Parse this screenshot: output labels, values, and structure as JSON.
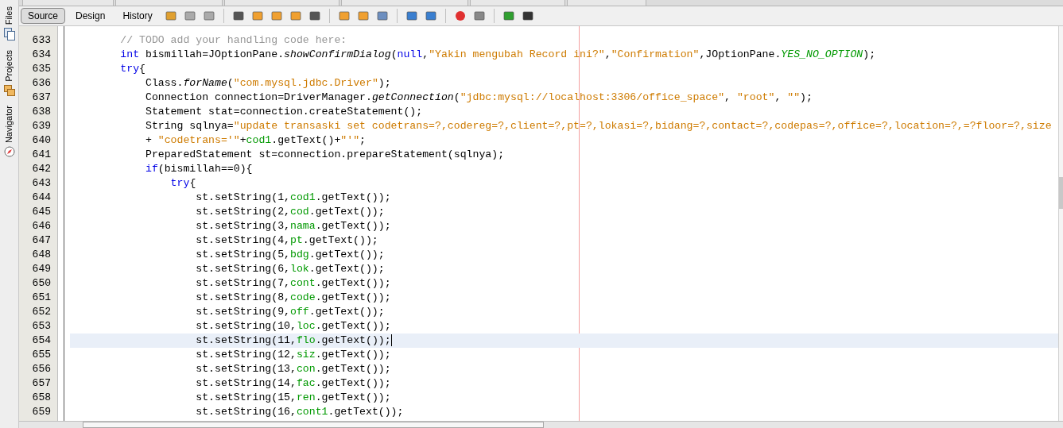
{
  "side_tabs": [
    {
      "label": "Files"
    },
    {
      "label": "Projects"
    },
    {
      "label": "Navigator"
    }
  ],
  "view_tabs": [
    {
      "label": "Source",
      "selected": true
    },
    {
      "label": "Design",
      "selected": false
    },
    {
      "label": "History",
      "selected": false
    }
  ],
  "lines": [
    {
      "number": "633",
      "current": false,
      "tokens": [
        {
          "kind": "comment",
          "text": "        // TODO add your handling code here:"
        }
      ]
    },
    {
      "number": "634",
      "current": false,
      "tokens": [
        {
          "kind": "keyword",
          "text": "        int"
        },
        {
          "kind": "plain",
          "text": " bismillah=JOptionPane."
        },
        {
          "kind": "method",
          "text": "showConfirmDialog"
        },
        {
          "kind": "plain",
          "text": "("
        },
        {
          "kind": "keyword",
          "text": "null"
        },
        {
          "kind": "plain",
          "text": ","
        },
        {
          "kind": "string",
          "text": "\"Yakin mengubah Record ini?\""
        },
        {
          "kind": "plain",
          "text": ","
        },
        {
          "kind": "string",
          "text": "\"Confirmation\""
        },
        {
          "kind": "plain",
          "text": ",JOptionPane."
        },
        {
          "kind": "constant",
          "text": "YES_NO_OPTION"
        },
        {
          "kind": "plain",
          "text": ");"
        }
      ]
    },
    {
      "number": "635",
      "current": false,
      "tokens": [
        {
          "kind": "keyword",
          "text": "        try"
        },
        {
          "kind": "plain",
          "text": "{"
        }
      ]
    },
    {
      "number": "636",
      "current": false,
      "tokens": [
        {
          "kind": "plain",
          "text": "            Class."
        },
        {
          "kind": "method",
          "text": "forName"
        },
        {
          "kind": "plain",
          "text": "("
        },
        {
          "kind": "string",
          "text": "\"com.mysql.jdbc.Driver\""
        },
        {
          "kind": "plain",
          "text": ");"
        }
      ]
    },
    {
      "number": "637",
      "current": false,
      "tokens": [
        {
          "kind": "plain",
          "text": "            Connection connection=DriverManager."
        },
        {
          "kind": "method",
          "text": "getConnection"
        },
        {
          "kind": "plain",
          "text": "("
        },
        {
          "kind": "string",
          "text": "\"jdbc:mysql://localhost:3306/office_space\""
        },
        {
          "kind": "plain",
          "text": ", "
        },
        {
          "kind": "string",
          "text": "\"root\""
        },
        {
          "kind": "plain",
          "text": ", "
        },
        {
          "kind": "string",
          "text": "\"\""
        },
        {
          "kind": "plain",
          "text": ");"
        }
      ]
    },
    {
      "number": "638",
      "current": false,
      "tokens": [
        {
          "kind": "plain",
          "text": "            Statement stat=connection.createStatement();"
        }
      ]
    },
    {
      "number": "639",
      "current": false,
      "tokens": [
        {
          "kind": "plain",
          "text": "            String sqlnya="
        },
        {
          "kind": "string",
          "text": "\"update transaski set codetrans=?,codereg=?,client=?,pt=?,lokasi=?,bidang=?,contact=?,codepas=?,office=?,location=?,=?floor=?,size"
        }
      ]
    },
    {
      "number": "640",
      "current": false,
      "tokens": [
        {
          "kind": "plain",
          "text": "            + "
        },
        {
          "kind": "string",
          "text": "\"codetrans='\""
        },
        {
          "kind": "plain",
          "text": "+"
        },
        {
          "kind": "field",
          "text": "cod1"
        },
        {
          "kind": "plain",
          "text": ".getText()+"
        },
        {
          "kind": "string",
          "text": "\"'\""
        },
        {
          "kind": "plain",
          "text": ";"
        }
      ]
    },
    {
      "number": "641",
      "current": false,
      "tokens": [
        {
          "kind": "plain",
          "text": "            PreparedStatement st=connection.prepareStatement(sqlnya);"
        }
      ]
    },
    {
      "number": "642",
      "current": false,
      "tokens": [
        {
          "kind": "keyword",
          "text": "            if"
        },
        {
          "kind": "plain",
          "text": "(bismillah==0){"
        }
      ]
    },
    {
      "number": "643",
      "current": false,
      "tokens": [
        {
          "kind": "keyword",
          "text": "                try"
        },
        {
          "kind": "plain",
          "text": "{"
        }
      ]
    },
    {
      "number": "644",
      "current": false,
      "tokens": [
        {
          "kind": "plain",
          "text": "                    st.setString(1,"
        },
        {
          "kind": "field",
          "text": "cod1"
        },
        {
          "kind": "plain",
          "text": ".getText());"
        }
      ]
    },
    {
      "number": "645",
      "current": false,
      "tokens": [
        {
          "kind": "plain",
          "text": "                    st.setString(2,"
        },
        {
          "kind": "field",
          "text": "cod"
        },
        {
          "kind": "plain",
          "text": ".getText());"
        }
      ]
    },
    {
      "number": "646",
      "current": false,
      "tokens": [
        {
          "kind": "plain",
          "text": "                    st.setString(3,"
        },
        {
          "kind": "field",
          "text": "nama"
        },
        {
          "kind": "plain",
          "text": ".getText());"
        }
      ]
    },
    {
      "number": "647",
      "current": false,
      "tokens": [
        {
          "kind": "plain",
          "text": "                    st.setString(4,"
        },
        {
          "kind": "field",
          "text": "pt"
        },
        {
          "kind": "plain",
          "text": ".getText());"
        }
      ]
    },
    {
      "number": "648",
      "current": false,
      "tokens": [
        {
          "kind": "plain",
          "text": "                    st.setString(5,"
        },
        {
          "kind": "field",
          "text": "bdg"
        },
        {
          "kind": "plain",
          "text": ".getText());"
        }
      ]
    },
    {
      "number": "649",
      "current": false,
      "tokens": [
        {
          "kind": "plain",
          "text": "                    st.setString(6,"
        },
        {
          "kind": "field",
          "text": "lok"
        },
        {
          "kind": "plain",
          "text": ".getText());"
        }
      ]
    },
    {
      "number": "650",
      "current": false,
      "tokens": [
        {
          "kind": "plain",
          "text": "                    st.setString(7,"
        },
        {
          "kind": "field",
          "text": "cont"
        },
        {
          "kind": "plain",
          "text": ".getText());"
        }
      ]
    },
    {
      "number": "651",
      "current": false,
      "tokens": [
        {
          "kind": "plain",
          "text": "                    st.setString(8,"
        },
        {
          "kind": "field",
          "text": "code"
        },
        {
          "kind": "plain",
          "text": ".getText());"
        }
      ]
    },
    {
      "number": "652",
      "current": false,
      "tokens": [
        {
          "kind": "plain",
          "text": "                    st.setString(9,"
        },
        {
          "kind": "field",
          "text": "off"
        },
        {
          "kind": "plain",
          "text": ".getText());"
        }
      ]
    },
    {
      "number": "653",
      "current": false,
      "tokens": [
        {
          "kind": "plain",
          "text": "                    st.setString(10,"
        },
        {
          "kind": "field",
          "text": "loc"
        },
        {
          "kind": "plain",
          "text": ".getText());"
        }
      ]
    },
    {
      "number": "654",
      "current": true,
      "tokens": [
        {
          "kind": "plain",
          "text": "                    st.setString(11,"
        },
        {
          "kind": "field",
          "text": "flo"
        },
        {
          "kind": "plain",
          "text": ".getText());"
        }
      ]
    },
    {
      "number": "655",
      "current": false,
      "tokens": [
        {
          "kind": "plain",
          "text": "                    st.setString(12,"
        },
        {
          "kind": "field",
          "text": "siz"
        },
        {
          "kind": "plain",
          "text": ".getText());"
        }
      ]
    },
    {
      "number": "656",
      "current": false,
      "tokens": [
        {
          "kind": "plain",
          "text": "                    st.setString(13,"
        },
        {
          "kind": "field",
          "text": "con"
        },
        {
          "kind": "plain",
          "text": ".getText());"
        }
      ]
    },
    {
      "number": "657",
      "current": false,
      "tokens": [
        {
          "kind": "plain",
          "text": "                    st.setString(14,"
        },
        {
          "kind": "field",
          "text": "fac"
        },
        {
          "kind": "plain",
          "text": ".getText());"
        }
      ]
    },
    {
      "number": "658",
      "current": false,
      "tokens": [
        {
          "kind": "plain",
          "text": "                    st.setString(15,"
        },
        {
          "kind": "field",
          "text": "ren"
        },
        {
          "kind": "plain",
          "text": ".getText());"
        }
      ]
    },
    {
      "number": "659",
      "current": false,
      "tokens": [
        {
          "kind": "plain",
          "text": "                    st.setString(16,"
        },
        {
          "kind": "field",
          "text": "cont1"
        },
        {
          "kind": "plain",
          "text": ".getText());"
        }
      ]
    }
  ]
}
